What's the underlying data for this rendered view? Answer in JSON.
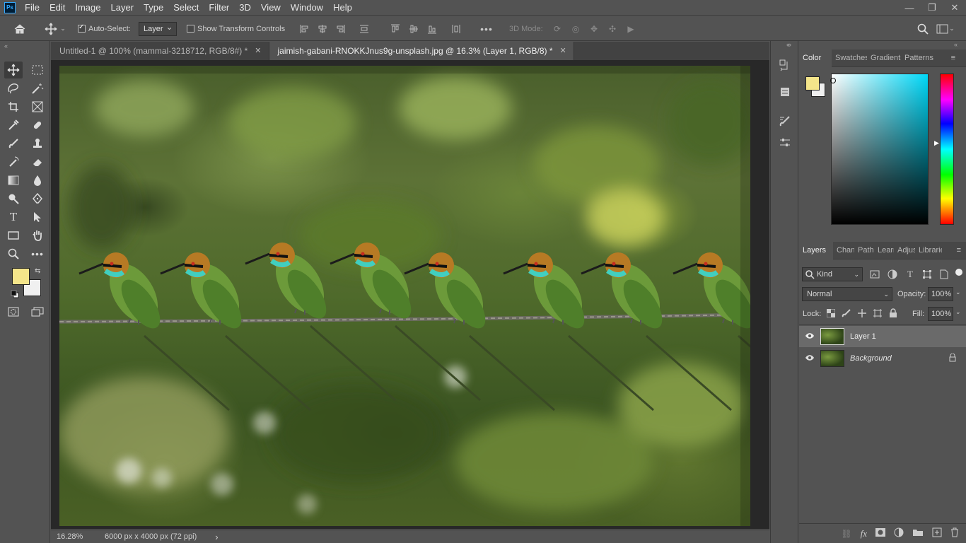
{
  "app": {
    "logo_text": "Ps"
  },
  "menu": [
    "File",
    "Edit",
    "Image",
    "Layer",
    "Type",
    "Select",
    "Filter",
    "3D",
    "View",
    "Window",
    "Help"
  ],
  "window_controls": {
    "minimize": "—",
    "restore": "❐",
    "close": "✕"
  },
  "options_bar": {
    "auto_select_label": "Auto-Select:",
    "auto_select_checked": true,
    "auto_select_value": "Layer",
    "show_transform_label": "Show Transform Controls",
    "show_transform_checked": false,
    "more_label": "•••",
    "mode_3d_label": "3D Mode:"
  },
  "tabs": [
    {
      "label": "Untitled-1 @ 100% (mammal-3218712, RGB/8#) *",
      "active": false
    },
    {
      "label": "jaimish-gabani-RNOKKJnus9g-unsplash.jpg @ 16.3% (Layer 1, RGB/8) *",
      "active": true
    }
  ],
  "tab_close": "✕",
  "status": {
    "zoom": "16.28%",
    "doc_info": "6000 px x 4000 px (72 ppi)",
    "arrow": "›"
  },
  "colors": {
    "foreground": "#f4e58a",
    "background": "#f0f0f0",
    "accent_hue": "#00d8f8"
  },
  "color_panel": {
    "tabs": [
      "Color",
      "Swatches",
      "Gradients",
      "Patterns"
    ],
    "active": "Color"
  },
  "layers_panel": {
    "tabs": [
      "Layers",
      "Channels",
      "Paths",
      "Learn",
      "Adjustments",
      "Libraries"
    ],
    "active": "Layers",
    "kind_filter": "Kind",
    "blend_mode": "Normal",
    "opacity_label": "Opacity:",
    "opacity_value": "100%",
    "lock_label": "Lock:",
    "fill_label": "Fill:",
    "fill_value": "100%",
    "layers": [
      {
        "name": "Layer 1",
        "selected": true,
        "locked": false
      },
      {
        "name": "Background",
        "selected": false,
        "locked": true
      }
    ]
  }
}
